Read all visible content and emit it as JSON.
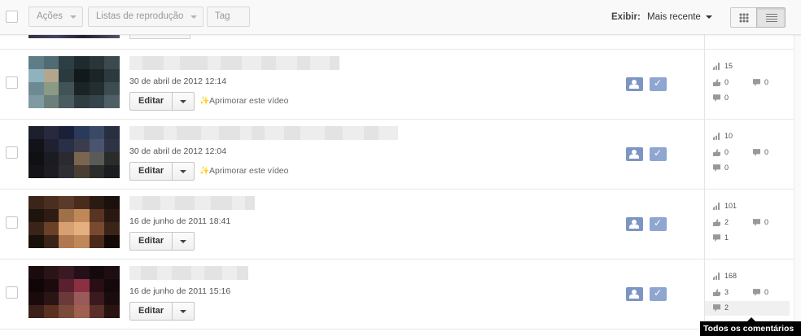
{
  "toolbar": {
    "actions_label": "Ações",
    "playlists_label": "Listas de reprodução",
    "tag_label": "Tag",
    "view_label": "Exibir:",
    "sort_value": "Mais recente"
  },
  "videos": [
    {
      "date": "30 de abril de 2012 12:14",
      "edit_label": "Editar",
      "enhance_label": "Aprimorar este vídeo",
      "views": "15",
      "likes": "0",
      "dislikes": "0",
      "comments": "0",
      "thumb_colors": [
        "#5e7d86",
        "#4f6b73",
        "#2d3e44",
        "#1f2a2e",
        "#2a3537",
        "#3a4a4f",
        "#8fb2bf",
        "#b2a78c",
        "#2a3a3d",
        "#12191b",
        "#1b2427",
        "#2c3a3e",
        "#6d8a93",
        "#8b9a86",
        "#415356",
        "#1a2326",
        "#232e31",
        "#3c4c50",
        "#7f9aa3",
        "#6d7f7b",
        "#4b5c60",
        "#2f3d41",
        "#35444a",
        "#4e6065"
      ],
      "title_blocks": [
        16,
        26,
        20,
        34,
        16,
        26,
        24,
        18,
        26,
        16,
        24,
        12
      ]
    },
    {
      "date": "30 de abril de 2012 12:04",
      "edit_label": "Editar",
      "enhance_label": "Aprimorar este vídeo",
      "views": "10",
      "likes": "0",
      "dislikes": "0",
      "comments": "0",
      "thumb_colors": [
        "#1c1f2c",
        "#262a3c",
        "#1a2038",
        "#2a3a5a",
        "#3a4a66",
        "#2a2f40",
        "#121219",
        "#1f2030",
        "#2a2f48",
        "#3b3d4c",
        "#4a5370",
        "#2e3345",
        "#0f0f14",
        "#1b1c22",
        "#2a2a30",
        "#7a6550",
        "#5a5a58",
        "#2a2c2a",
        "#141418",
        "#1c1c22",
        "#2e2e34",
        "#4a3e33",
        "#2a2d2a",
        "#1c1d20"
      ],
      "title_blocks": [
        18,
        24,
        16,
        30,
        22,
        26,
        14,
        16,
        24,
        20,
        30,
        22,
        26,
        18,
        24
      ]
    },
    {
      "date": "16 de junho de 2011 18:41",
      "edit_label": "Editar",
      "enhance_label": "",
      "views": "101",
      "likes": "2",
      "dislikes": "0",
      "comments": "1",
      "thumb_colors": [
        "#3a2518",
        "#4a2f20",
        "#5a3a28",
        "#4a2c1c",
        "#2a1a12",
        "#1a100c",
        "#1e140e",
        "#2e1c14",
        "#a0704a",
        "#c08858",
        "#5a3422",
        "#2a1810",
        "#3a2418",
        "#6a4028",
        "#d8a070",
        "#e4b080",
        "#7a4a30",
        "#3a2418",
        "#1a100a",
        "#3a2418",
        "#b07850",
        "#c08858",
        "#4a2a1a",
        "#120a06"
      ],
      "title_blocks": [
        16,
        22,
        18,
        24,
        20,
        26,
        16,
        12
      ]
    },
    {
      "date": "16 de junho de 2011 15:16",
      "edit_label": "Editar",
      "enhance_label": "",
      "views": "168",
      "likes": "3",
      "dislikes": "0",
      "comments": "2",
      "thumb_colors": [
        "#1a0c0e",
        "#2a1418",
        "#3a1a22",
        "#24101a",
        "#140a0e",
        "#1e0e12",
        "#100608",
        "#1c0a0e",
        "#5a2030",
        "#8a3040",
        "#2a0e16",
        "#14080a",
        "#1a0a0c",
        "#2a1416",
        "#6a3a3a",
        "#9a5a5a",
        "#3a1a1e",
        "#1a0c0e",
        "#3a2018",
        "#5a3020",
        "#7a4a3a",
        "#a06050",
        "#5a3028",
        "#2a1410"
      ],
      "title_blocks": [
        14,
        20,
        18,
        24,
        16,
        22,
        18,
        14
      ]
    }
  ],
  "tooltip": "Todos os comentários",
  "colors": {
    "status_public": "#7d95c3",
    "status_check": "#8fa6d1",
    "title_blur_a": "#ededed",
    "title_blur_b": "#e3e3e3"
  }
}
